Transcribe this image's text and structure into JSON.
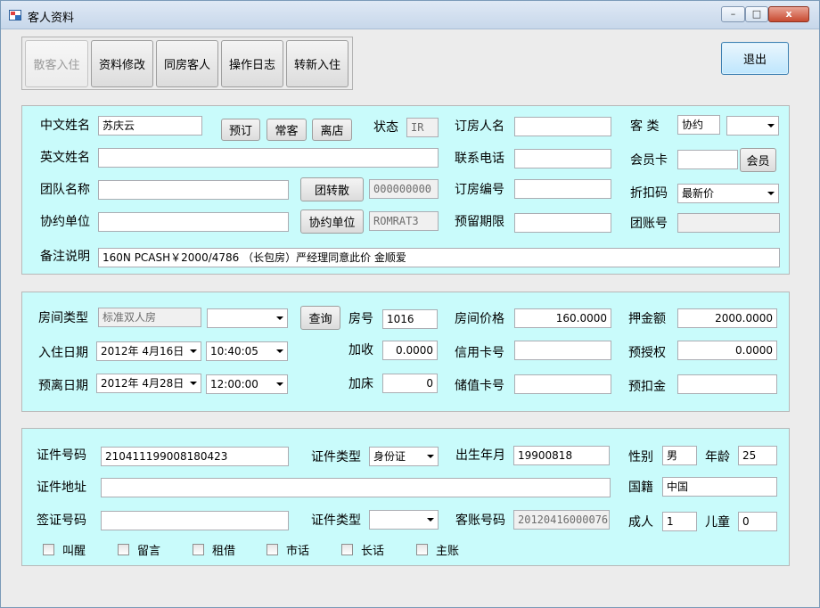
{
  "window": {
    "title": "客人资料",
    "min_label": "–",
    "max_label": "□",
    "close_label": "x"
  },
  "toolbar": {
    "walkin_checkin": "散客入住",
    "edit_info": "资料修改",
    "same_room_guest": "同房客人",
    "operation_log": "操作日志",
    "transfer_checkin": "转新入住",
    "exit": "退出"
  },
  "guest": {
    "chinese_name_label": "中文姓名",
    "chinese_name": "苏庆云",
    "reserve_btn": "预订",
    "regular_btn": "常客",
    "checkout_btn": "离店",
    "status_label": "状态",
    "status": "IR",
    "booker_label": "订房人名",
    "booker": "",
    "guest_type_label": "客  类",
    "guest_type": "协约",
    "guest_type_sub": "",
    "english_name_label": "英文姓名",
    "english_name": "",
    "phone_label": "联系电话",
    "phone": "",
    "member_card_label": "会员卡",
    "member_card": "",
    "member_btn": "会员",
    "group_label": "团队名称",
    "group": "",
    "group_transfer_btn": "团转散",
    "group_code": "000000000",
    "booking_no_label": "订房编号",
    "booking_no": "",
    "discount_label": "折扣码",
    "discount": "最新价",
    "contract_label": "协约单位",
    "contract": "",
    "contract_btn": "协约单位",
    "contract_code": "ROMRAT3",
    "hold_label": "预留期限",
    "hold": "",
    "group_account_label": "团账号",
    "group_account": "",
    "remarks_label": "备注说明",
    "remarks": "160N PCASH￥2000/4786 （长包房）严经理同意此价 金顺爱"
  },
  "room": {
    "type_label": "房间类型",
    "type": "标准双人房",
    "type_sub": "",
    "query_btn": "查询",
    "room_no_label": "房号",
    "room_no": "1016",
    "price_label": "房间价格",
    "price": "160.0000",
    "deposit_label": "押金额",
    "deposit": "2000.0000",
    "checkin_label": "入住日期",
    "checkin_date": "2012年 4月16日",
    "checkin_time": "10:40:05",
    "extra_charge_label": "加收",
    "extra_charge": "0.0000",
    "credit_card_label": "信用卡号",
    "credit_card": "",
    "preauth_label": "预授权",
    "preauth": "0.0000",
    "checkout_label": "预离日期",
    "checkout_date": "2012年 4月28日",
    "checkout_time": "12:00:00",
    "extra_bed_label": "加床",
    "extra_bed": "0",
    "stored_card_label": "储值卡号",
    "stored_card": "",
    "prededuct_label": "预扣金",
    "prededuct": ""
  },
  "identity": {
    "id_no_label": "证件号码",
    "id_no": "210411199008180423",
    "id_type_label": "证件类型",
    "id_type": "身份证",
    "birth_label": "出生年月",
    "birth": "19900818",
    "gender_label": "性别",
    "gender": "男",
    "age_label": "年龄",
    "age": "25",
    "address_label": "证件地址",
    "address": "",
    "nationality_label": "国籍",
    "nationality": "中国",
    "visa_no_label": "签证号码",
    "visa_no": "",
    "visa_type_label": "证件类型",
    "visa_type": "",
    "account_no_label": "客账号码",
    "account_no": "20120416000076",
    "adults_label": "成人",
    "adults": "1",
    "children_label": "儿童",
    "children": "0",
    "checkboxes": [
      "叫醒",
      "留言",
      "租借",
      "市话",
      "长话",
      "主账"
    ]
  }
}
